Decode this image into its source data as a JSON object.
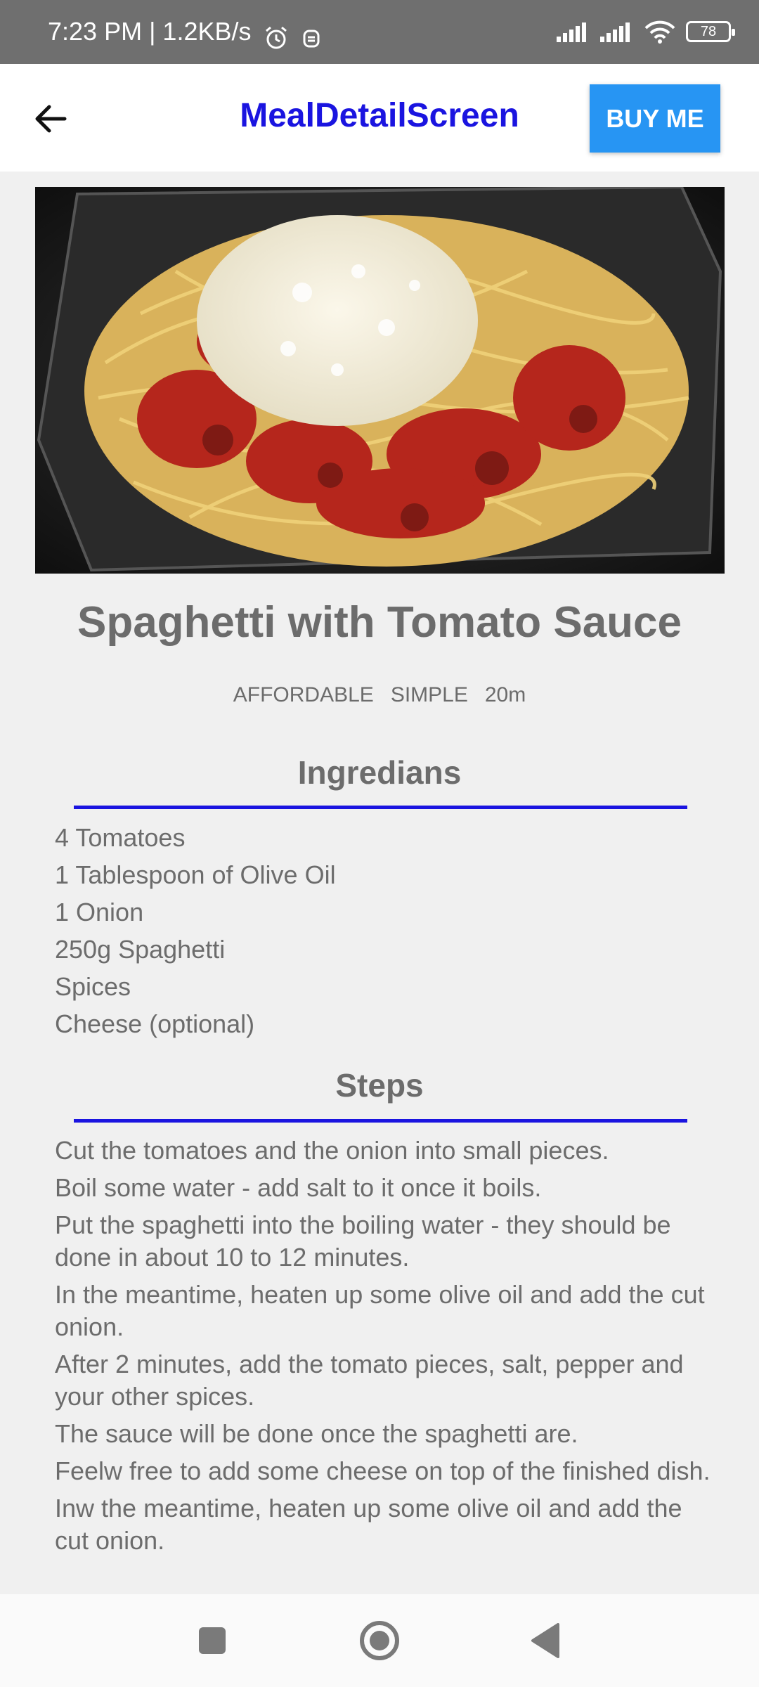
{
  "status_bar": {
    "time": "7:23 PM | 1.2KB/s",
    "battery": "78",
    "icons": [
      "alarm-icon",
      "notification-icon",
      "signal-icon",
      "signal-icon",
      "wifi-icon",
      "battery-icon"
    ]
  },
  "app_bar": {
    "title": "MealDetailScreen",
    "buy_label": "BUY ME",
    "back_icon": "arrow-left-icon"
  },
  "meal": {
    "title": "Spaghetti with Tomato Sauce",
    "affordability": "AFFORDABLE",
    "complexity": "SIMPLE",
    "duration": "20m"
  },
  "ingredients": {
    "heading": "Ingredians",
    "items": [
      "4 Tomatoes",
      "1 Tablespoon of Olive Oil",
      "1 Onion",
      "250g Spaghetti",
      "Spices",
      "Cheese (optional)"
    ]
  },
  "steps": {
    "heading": "Steps",
    "items": [
      "Cut the tomatoes and the onion into small pieces.",
      "Boil some water - add salt to it once it boils.",
      "Put the spaghetti into the boiling water - they should be done in about 10 to 12 minutes.",
      "In the meantime, heaten up some olive oil and add the cut onion.",
      "After 2 minutes, add the tomato pieces, salt, pepper and your other spices.",
      "The sauce will be done once the spaghetti are.",
      "Feelw free to add some cheese on top of the finished dish.",
      "Inw the meantime, heaten up some olive oil and add the cut onion."
    ]
  },
  "colors": {
    "accent": "#1a14e0",
    "button": "#2795f3",
    "text": "#6c6c6c",
    "background": "#f0f0f0"
  }
}
